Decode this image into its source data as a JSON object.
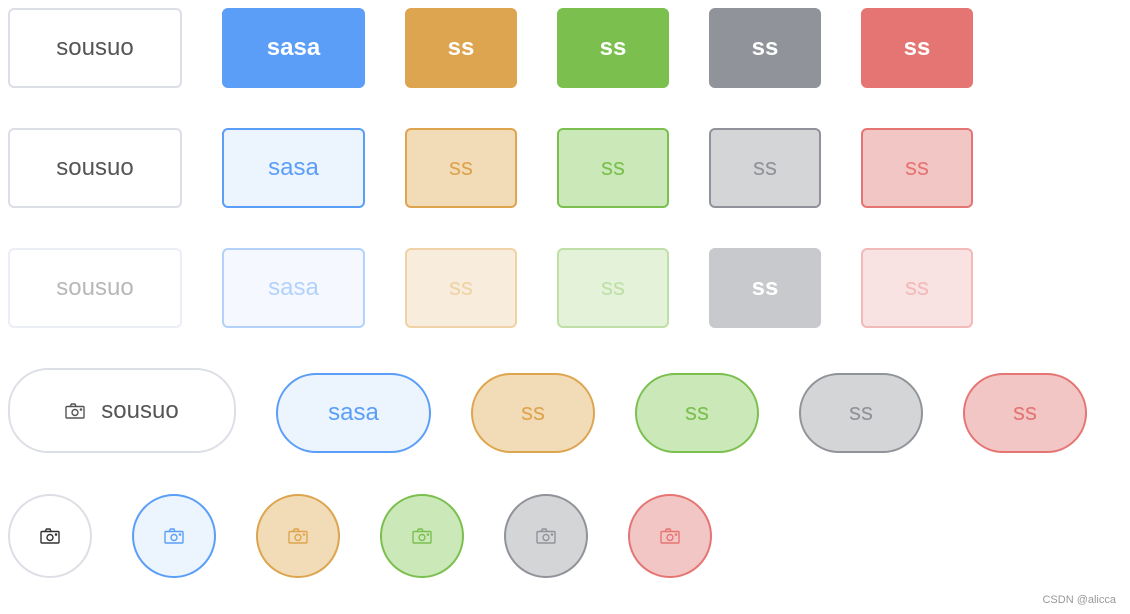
{
  "rows": {
    "solid": {
      "default": "sousuo",
      "primary": "sasa",
      "warning": "ss",
      "success": "ss",
      "info": "ss",
      "danger": "ss"
    },
    "plain": {
      "default": "sousuo",
      "primary": "sasa",
      "warning": "ss",
      "success": "ss",
      "info": "ss",
      "danger": "ss"
    },
    "disabled": {
      "default": "sousuo",
      "primary": "sasa",
      "warning": "ss",
      "success": "ss",
      "info": "ss",
      "danger": "ss"
    },
    "round": {
      "default": "sousuo",
      "primary": "sasa",
      "warning": "ss",
      "success": "ss",
      "info": "ss",
      "danger": "ss"
    },
    "circle_icons": [
      "camera-icon",
      "camera-icon",
      "camera-icon",
      "camera-icon",
      "camera-icon",
      "camera-icon"
    ]
  },
  "colors": {
    "primary": "#5b9ef8",
    "warning": "#dda54f",
    "success": "#7bc04f",
    "info": "#909399",
    "danger": "#e57573",
    "default_border": "#dcdfe6"
  },
  "watermark": "CSDN @alicca"
}
